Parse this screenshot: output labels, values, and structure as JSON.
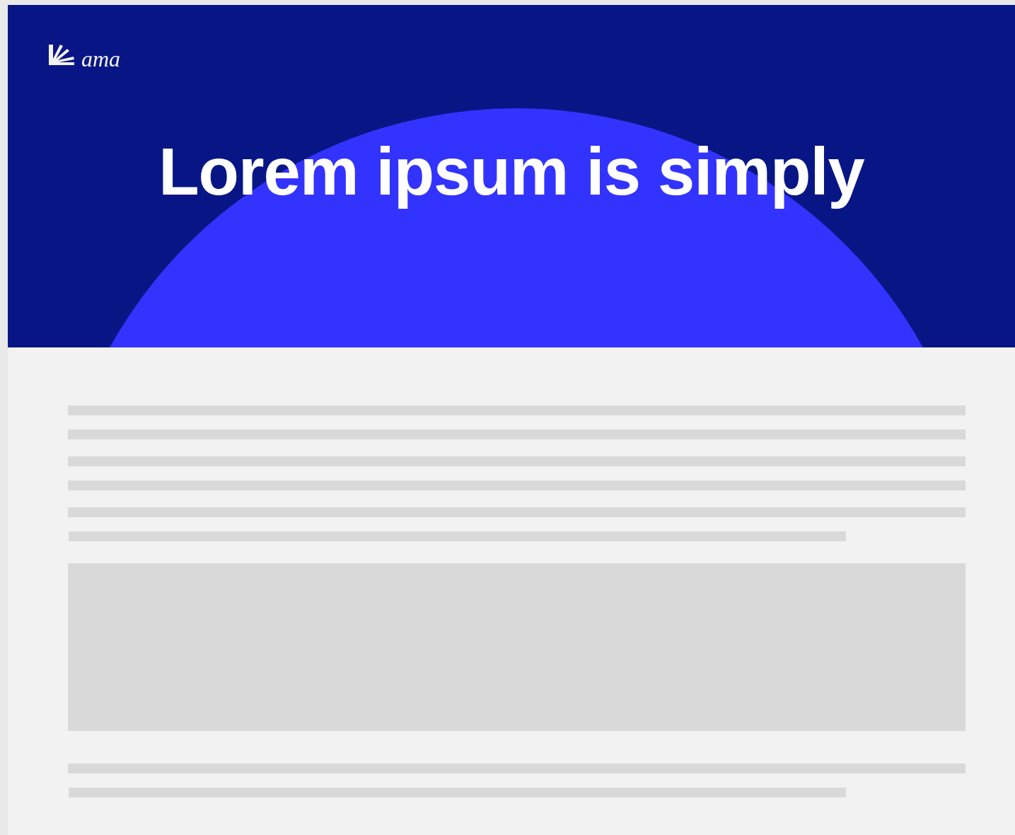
{
  "header": {
    "logo_text": "ama",
    "title": "Lorem ipsum is simply"
  },
  "content": [
    {
      "kind": "text",
      "lines": [
        {
          "kind": "full"
        },
        {
          "kind": "full"
        }
      ]
    },
    {
      "kind": "text",
      "lines": [
        {
          "kind": "full"
        },
        {
          "kind": "full"
        }
      ]
    },
    {
      "kind": "text",
      "lines": [
        {
          "kind": "full"
        },
        {
          "kind": "short"
        }
      ]
    },
    {
      "kind": "block"
    },
    {
      "kind": "text",
      "lines": [
        {
          "kind": "full"
        },
        {
          "kind": "short"
        }
      ]
    }
  ]
}
